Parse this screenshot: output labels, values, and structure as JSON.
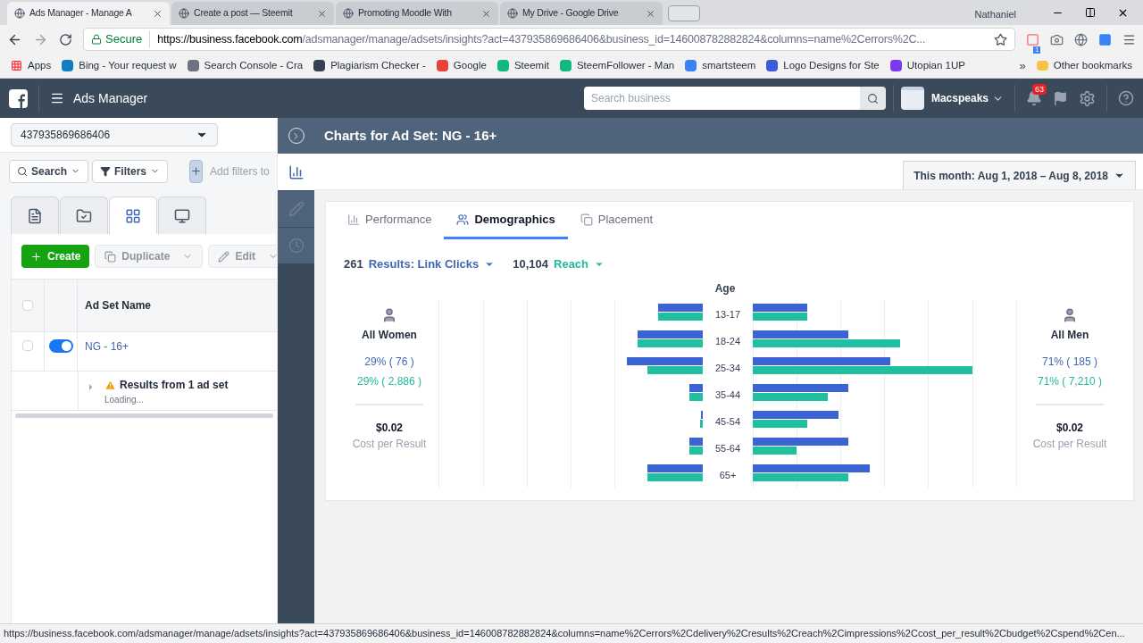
{
  "browser": {
    "tabs": [
      {
        "title": "Ads Manager - Manage A",
        "selected": true
      },
      {
        "title": "Create a post — Steemit",
        "selected": false
      },
      {
        "title": "Promoting Moodle With",
        "selected": false
      },
      {
        "title": "My Drive - Google Drive",
        "selected": false
      }
    ],
    "user": "Nathaniel",
    "secure_label": "Secure",
    "url_host": "https://business.facebook.com",
    "url_path": "/adsmanager/manage/adsets/insights?act=437935869686406&business_id=146008782882824&columns=name%2Cerrors%2C...",
    "extension_badge": "1",
    "bookmarks": [
      "Apps",
      "Bing - Your request w",
      "Search Console - Cra",
      "Plagiarism Checker -",
      "Google",
      "Steemit",
      "SteemFollower - Man",
      "smartsteem",
      "Logo Designs for Ste",
      "Utopian 1UP"
    ],
    "more_bookmarks": "»",
    "other_bookmarks": "Other bookmarks"
  },
  "header": {
    "app_title": "Ads Manager",
    "search_placeholder": "Search business",
    "account": "Macspeaks",
    "notifications": "63"
  },
  "left": {
    "account_id": "437935869686406",
    "search": "Search",
    "filters": "Filters",
    "add_filters_placeholder": "Add filters to",
    "view_tabs": [
      {
        "selected": false
      },
      {
        "selected": false
      },
      {
        "selected": true
      },
      {
        "selected": false
      }
    ],
    "actions": [
      {
        "label": "Create",
        "disabled": false
      },
      {
        "label": "Duplicate",
        "disabled": true
      },
      {
        "label": "Edit",
        "disabled": true
      }
    ],
    "column": "Ad Set Name",
    "header_checked": false,
    "rows": [
      {
        "name": "NG - 16+",
        "checked": false,
        "on": true
      }
    ],
    "summary": {
      "title": "Results from 1 ad set",
      "status": "Loading..."
    }
  },
  "panel": {
    "title": "Charts for Ad Set: NG - 16+",
    "side_nav": [
      {
        "selected": true
      },
      {
        "selected": false
      },
      {
        "selected": false
      }
    ],
    "date_range": "This month: Aug 1, 2018 – Aug 8, 2018",
    "tabs": [
      {
        "label": "Performance",
        "selected": false
      },
      {
        "label": "Demographics",
        "selected": true
      },
      {
        "label": "Placement",
        "selected": false
      }
    ],
    "results": {
      "value": "261",
      "label": "Results: Link Clicks"
    },
    "reach": {
      "value": "10,104",
      "label": "Reach"
    },
    "axis_title": "Age",
    "ages": [
      "13-17",
      "18-24",
      "25-34",
      "35-44",
      "45-54",
      "55-64",
      "65+"
    ],
    "women": {
      "label": "All Women",
      "results": "29% ( 76 )",
      "reach": "29% ( 2,886 )",
      "cost": "$0.02",
      "cost_label": "Cost per Result"
    },
    "men": {
      "label": "All Men",
      "results": "71% ( 185 )",
      "reach": "71% ( 7,210 )",
      "cost": "$0.02",
      "cost_label": "Cost per Result"
    }
  },
  "status_url": "https://business.facebook.com/adsmanager/manage/adsets/insights?act=437935869686406&business_id=146008782882824&columns=name%2Cerrors%2Cdelivery%2Cresults%2Creach%2Cimpressions%2Ccost_per_result%2Cbudget%2Cspend%2Cen..."
}
